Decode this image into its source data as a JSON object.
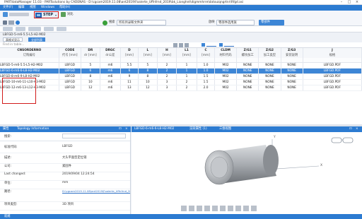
{
  "window": {
    "title": "PARTdataManager 11.03 - PARTsolutions by CADENAS - D:\\cgcam2019.11.08\\ant2019\\Foalerte_Uffnfrnd_2019\\bk_Lionghnt\\digmmhrre\\datouiqngrtnr\\Rfgd.asi"
  },
  "menu": {
    "items": [
      "文件(F)",
      "编辑",
      "视图",
      "Windows",
      "帮助(H)"
    ]
  },
  "ribbon": {
    "step_label": "STEP",
    "to_browser": "对比",
    "row2": {
      "scope_label": "搜索",
      "scope_value": "所有目录和文件夹",
      "show_label": "放映",
      "show_value": "零部件选用族",
      "blue_btn": "零部件"
    }
  },
  "path": {
    "text": "LBFGD-5-m6-5.5-L5-H2-M02",
    "tabs": [
      "表格式显示",
      "全部列表"
    ]
  },
  "find": {
    "placeholder": "Find in table..."
  },
  "table": {
    "headers": [
      "CNSORDERNO",
      "CODE",
      "DR",
      "DRGC",
      "D",
      "L",
      "H",
      "L1",
      "C",
      "CLDM",
      "Z/G1",
      "Z/G2",
      "Z/G3",
      "J"
    ],
    "subheaders": [
      "订购编号",
      "代号 [mm]",
      "dr [mm]",
      "dr公差",
      "[mm]",
      "[mm]",
      "[mm]",
      "[mm]",
      "[mm]",
      "材料代码",
      "螺纹加工",
      "加工类型",
      "安装说明",
      "规格"
    ],
    "rows": [
      [
        "LBFGD-5-m6-5.5-L5-H2-M02",
        "LBFGD",
        "5",
        "m6",
        "5.5",
        "5",
        "2",
        "1",
        "1.0",
        "M02",
        "NONE",
        "NONE",
        "NONE",
        "LBFGD.PDF"
      ],
      [
        "LBFGD-6-m6-6-L8-H2-M02",
        "LBFGD",
        "6",
        "m6",
        "6",
        "8",
        "2",
        "1",
        "1.0",
        "M02",
        "NONE",
        "NONE",
        "NONE",
        "LBFGD.PDF"
      ],
      [
        "LBFGD-8-m6-9-L8-H2-M02",
        "LBFGD",
        "8",
        "m6",
        "9",
        "8",
        "2",
        "1",
        "1.5",
        "M02",
        "NONE",
        "NONE",
        "NONE",
        "LBFGD.PDF"
      ],
      [
        "LBFGD-10-m6-11-L10-H3-M02",
        "LBFGD",
        "10",
        "m6",
        "11",
        "10",
        "3",
        "2",
        "1.5",
        "M02",
        "NONE",
        "NONE",
        "NONE",
        "LBFGD.PDF"
      ],
      [
        "LBFGD-12-m6-13-L12-H3-M02",
        "LBFGD",
        "12",
        "m6",
        "13",
        "12",
        "3",
        "2",
        "2.0",
        "M02",
        "NONE",
        "NONE",
        "NONE",
        "LBFGD.PDF"
      ]
    ],
    "selected_row": 1
  },
  "left_panel": {
    "tabs": [
      "属性",
      "Topology Information"
    ],
    "search_label": "搜索:",
    "props": [
      {
        "key": "标准代码:",
        "val": "LBFGD"
      },
      {
        "key": "描述:",
        "val": "大头平面型定位销"
      },
      {
        "key": "公司:",
        "val": "紧固件"
      },
      {
        "key": "Last changed:",
        "val": "2019/09/04 12:24:54"
      },
      {
        "key": "单位:",
        "val": "mm"
      },
      {
        "key": "路径:",
        "val": "D:\\cgcam2019.11.08\\ant2019\\Foalerte_Uffnfrnd_2019\\bk_Lionghnt\\digmmhrre\\datouiqngrtnr\\Rfgd.asi"
      },
      {
        "key": "项目类型:",
        "val": "3D 项目"
      }
    ]
  },
  "right_panel": {
    "tabs": [
      "LBFGD-6-m6-6-L8-H2-M02",
      "渲染属性 (1)",
      "三维视图"
    ],
    "axis_y": "Y",
    "axis_x": "X"
  },
  "status": {
    "text": "就绪"
  },
  "colors": {
    "accent": "#2c7bd1",
    "selection": "#3d86d6",
    "highlight": "#d11a1a"
  }
}
